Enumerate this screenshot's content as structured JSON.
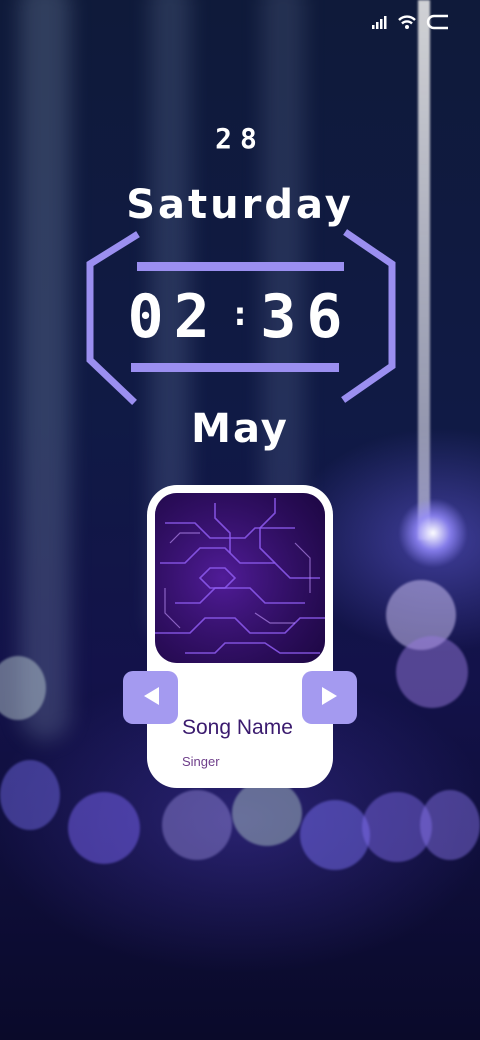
{
  "status_bar": {
    "icons": [
      "signal-icon",
      "wifi-icon",
      "battery-icon"
    ]
  },
  "date": {
    "day_number": "28",
    "weekday": "Saturday",
    "month": "May"
  },
  "clock": {
    "hours": "02",
    "separator": ":",
    "minutes": "36",
    "frame_color": "#9b8ff0"
  },
  "music_card": {
    "song_name": "Song Name",
    "singer": "Singer",
    "prev_icon": "play-left-icon",
    "next_icon": "play-right-icon",
    "button_color": "#a49af0",
    "title_color": "#3a1a6e"
  }
}
